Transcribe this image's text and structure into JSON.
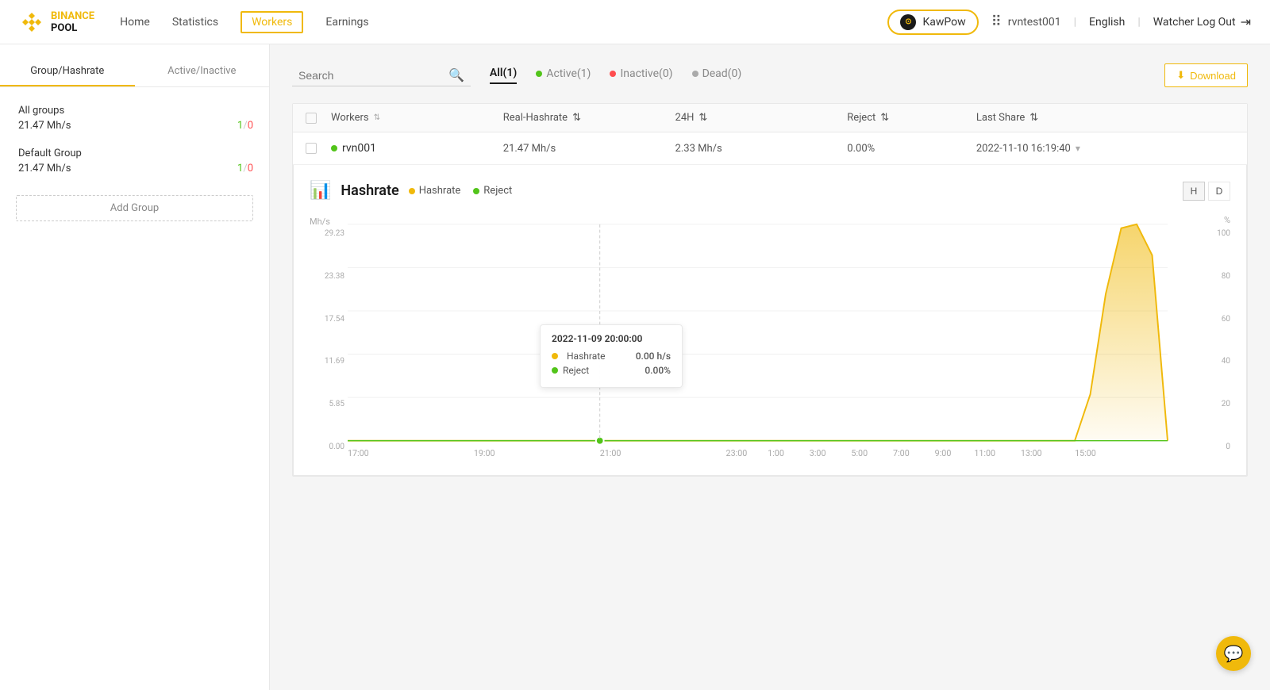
{
  "logo": {
    "name1": "BINANCE",
    "name2": "POOL"
  },
  "nav": {
    "items": [
      {
        "label": "Home",
        "active": false
      },
      {
        "label": "Statistics",
        "active": false
      },
      {
        "label": "Workers",
        "active": true
      },
      {
        "label": "Earnings",
        "active": false
      }
    ]
  },
  "header": {
    "coin": "KawPow",
    "username": "rvntest001",
    "language": "English",
    "logout_label": "Watcher Log Out"
  },
  "sidebar": {
    "tab1": "Group/Hashrate",
    "tab2": "Active/Inactive",
    "groups": [
      {
        "name": "All groups",
        "hashrate": "21.47 Mh/s",
        "active": "1",
        "inactive": "0"
      },
      {
        "name": "Default Group",
        "hashrate": "21.47 Mh/s",
        "active": "1",
        "inactive": "0"
      }
    ],
    "add_group": "Add Group"
  },
  "filter": {
    "search_placeholder": "Search",
    "tabs": [
      {
        "label": "All(1)",
        "active": true,
        "dot": null
      },
      {
        "label": "Active(1)",
        "active": false,
        "dot": "green"
      },
      {
        "label": "Inactive(0)",
        "active": false,
        "dot": "red"
      },
      {
        "label": "Dead(0)",
        "active": false,
        "dot": "gray"
      }
    ],
    "download": "Download"
  },
  "table": {
    "columns": [
      "Workers",
      "Real-Hashrate",
      "24H",
      "Reject",
      "Last Share"
    ],
    "rows": [
      {
        "name": "rvn001",
        "status": "active",
        "hashrate": "21.47 Mh/s",
        "h24": "2.33 Mh/s",
        "reject": "0.00%",
        "last_share": "2022-11-10 16:19:40"
      }
    ]
  },
  "chart": {
    "title": "Hashrate",
    "legend": [
      "Hashrate",
      "Reject"
    ],
    "y_labels": [
      "29.23",
      "23.38",
      "17.54",
      "11.69",
      "5.85",
      "0.00"
    ],
    "y_right_labels": [
      "100",
      "80",
      "60",
      "40",
      "20",
      "0"
    ],
    "y_axis_label": "Mh/s",
    "y_axis_right": "%",
    "x_labels": [
      "17:00",
      "19:00",
      "21:00",
      "23:00",
      "1:00",
      "3:00",
      "5:00",
      "7:00",
      "9:00",
      "11:00",
      "13:00",
      "15:00"
    ],
    "period_h": "H",
    "period_d": "D",
    "tooltip": {
      "time": "2022-11-09 20:00:00",
      "hashrate_label": "Hashrate",
      "hashrate_val": "0.00 h/s",
      "reject_label": "Reject",
      "reject_val": "0.00%"
    }
  }
}
